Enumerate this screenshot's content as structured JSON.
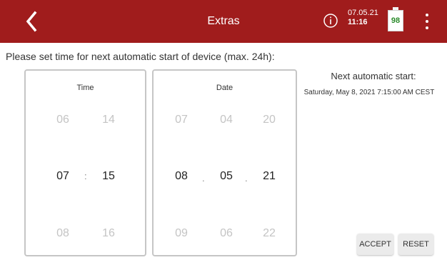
{
  "header": {
    "title": "Extras",
    "date": "07.05.21",
    "time": "11:16",
    "battery_level": "98",
    "back_icon": "chevron-left-icon",
    "info_icon": "info-icon",
    "menu_icon": "more-vertical-icon",
    "bar_color": "#a01c1c"
  },
  "prompt": "Please set time for next automatic start of device (max. 24h):",
  "time_picker": {
    "label": "Time",
    "separator": ":",
    "hours": [
      "06",
      "07",
      "08"
    ],
    "minutes": [
      "14",
      "15",
      "16"
    ]
  },
  "date_picker": {
    "label": "Date",
    "separator": ".",
    "days": [
      "07",
      "08",
      "09"
    ],
    "months": [
      "04",
      "05",
      "06"
    ],
    "years": [
      "20",
      "21",
      "22"
    ]
  },
  "next_start": {
    "label": "Next automatic start:",
    "value": "Saturday, May 8, 2021 7:15:00 AM CEST"
  },
  "buttons": {
    "accept": "ACCEPT",
    "reset": "RESET"
  }
}
